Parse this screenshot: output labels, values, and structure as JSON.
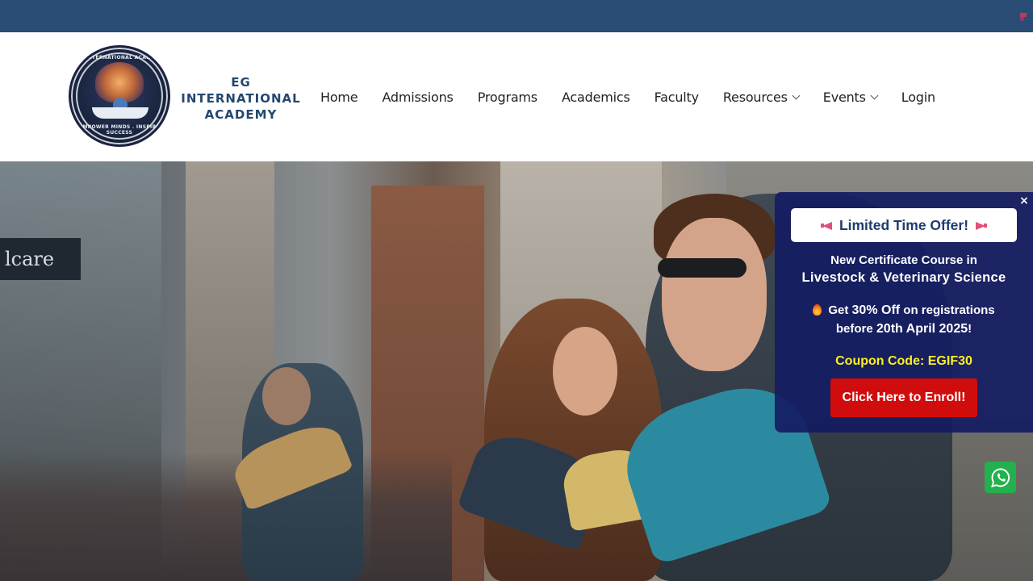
{
  "brand": {
    "name_line1": "EG",
    "name_line2": "INTERNATIONAL",
    "name_line3": "ACADEMY",
    "logo_top_text": "EG INTERNATIONAL ACADEMY",
    "logo_bottom_text": "EMPOWER MINDS . INSPIRE SUCCESS"
  },
  "nav": {
    "items": [
      {
        "label": "Home"
      },
      {
        "label": "Admissions"
      },
      {
        "label": "Programs"
      },
      {
        "label": "Academics"
      },
      {
        "label": "Faculty"
      },
      {
        "label": "Resources"
      },
      {
        "label": "Events"
      },
      {
        "label": "Login"
      }
    ]
  },
  "hero": {
    "sign_text": "lcare"
  },
  "popup": {
    "close_label": "×",
    "offer_title": "Limited Time Offer!",
    "line1": "New Certificate Course in",
    "line2": "Livestock & Veterinary Science",
    "discount_prefix": "Get",
    "discount_value": "30% Off",
    "discount_suffix": "on registrations",
    "deadline_prefix": "before",
    "deadline_date": "20th April 2025",
    "deadline_suffix": "!",
    "coupon": "Coupon Code: EGIF30",
    "enroll_label": "Click Here to Enroll!"
  },
  "colors": {
    "topbar": "#2b4c74",
    "brand_text": "#24486f",
    "popup_bg": "#141c62",
    "coupon_text": "#ffee22",
    "enroll_bg": "#d00c0c",
    "whatsapp_bg": "#22b14c"
  },
  "icons": {
    "topbar_flag": "flag-icon",
    "dropdown": "chevron-down-icon",
    "offer": "megaphone-icon",
    "discount": "fire-icon",
    "chat": "whatsapp-icon"
  }
}
